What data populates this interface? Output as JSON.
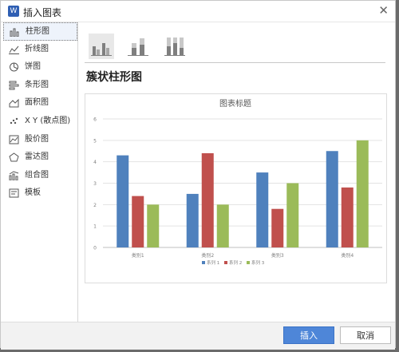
{
  "window": {
    "title": "插入图表",
    "app_icon": "W"
  },
  "sidebar": {
    "items": [
      {
        "label": "柱形图",
        "icon": "column-chart-icon",
        "selected": true
      },
      {
        "label": "折线图",
        "icon": "line-chart-icon",
        "selected": false
      },
      {
        "label": "饼图",
        "icon": "pie-chart-icon",
        "selected": false
      },
      {
        "label": "条形图",
        "icon": "bar-chart-icon",
        "selected": false
      },
      {
        "label": "面积图",
        "icon": "area-chart-icon",
        "selected": false
      },
      {
        "label": "X Y (散点图)",
        "icon": "scatter-chart-icon",
        "selected": false
      },
      {
        "label": "股价图",
        "icon": "stock-chart-icon",
        "selected": false
      },
      {
        "label": "雷达图",
        "icon": "radar-chart-icon",
        "selected": false
      },
      {
        "label": "组合图",
        "icon": "combo-chart-icon",
        "selected": false
      },
      {
        "label": "模板",
        "icon": "template-icon",
        "selected": false
      }
    ]
  },
  "main": {
    "subtypes": [
      {
        "icon": "clustered-column-icon",
        "selected": true
      },
      {
        "icon": "stacked-column-icon",
        "selected": false
      },
      {
        "icon": "percent-stacked-column-icon",
        "selected": false
      }
    ],
    "subtype_title": "簇状柱形图"
  },
  "footer": {
    "insert_label": "插入",
    "cancel_label": "取消"
  },
  "colors": {
    "series1": "#4f81bd",
    "series2": "#c0504d",
    "series3": "#9bbb59",
    "accent": "#4e86d8"
  },
  "chart_data": {
    "type": "bar",
    "title": "图表标题",
    "categories": [
      "类别1",
      "类别2",
      "类别3",
      "类别4"
    ],
    "series": [
      {
        "name": "系列 1",
        "values": [
          4.3,
          2.5,
          3.5,
          4.5
        ]
      },
      {
        "name": "系列 2",
        "values": [
          2.4,
          4.4,
          1.8,
          2.8
        ]
      },
      {
        "name": "系列 3",
        "values": [
          2,
          2,
          3,
          5
        ]
      }
    ],
    "ylim": [
      0,
      6
    ],
    "yticks": [
      0,
      1,
      2,
      3,
      4,
      5,
      6
    ],
    "grid": true,
    "legend": "bottom"
  }
}
